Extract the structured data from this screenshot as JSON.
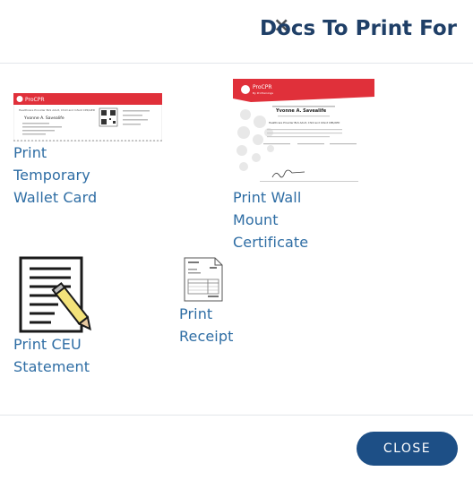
{
  "header": {
    "close_glyph": "×",
    "title": "Docs To Print For"
  },
  "documents": [
    {
      "id": "wallet-card",
      "label": "Print Temporary Wallet Card",
      "thumbnail": {
        "brand": "ProCPR",
        "course": "Healthcare Provider BLS Adult, Child and Infant CPR/AED",
        "name": "Yvonne A. Savealife"
      }
    },
    {
      "id": "wall-certificate",
      "label": "Print Wall Mount Certificate",
      "thumbnail": {
        "brand": "ProCPR",
        "sub": "By ProTrainings",
        "name": "Yvonne A. Savealife",
        "course": "Healthcare Provider BLS Adult, Child and Infant CPR/AED"
      }
    },
    {
      "id": "ceu-statement",
      "label": "Print CEU Statement",
      "icon": "document-pencil-icon"
    },
    {
      "id": "receipt",
      "label": "Print Receipt",
      "icon": "receipt-icon"
    }
  ],
  "footer": {
    "close_label": "CLOSE"
  },
  "colors": {
    "title": "#1f3f67",
    "link": "#2e6da4",
    "button": "#1d4f86",
    "brand_red": "#e0303a"
  }
}
